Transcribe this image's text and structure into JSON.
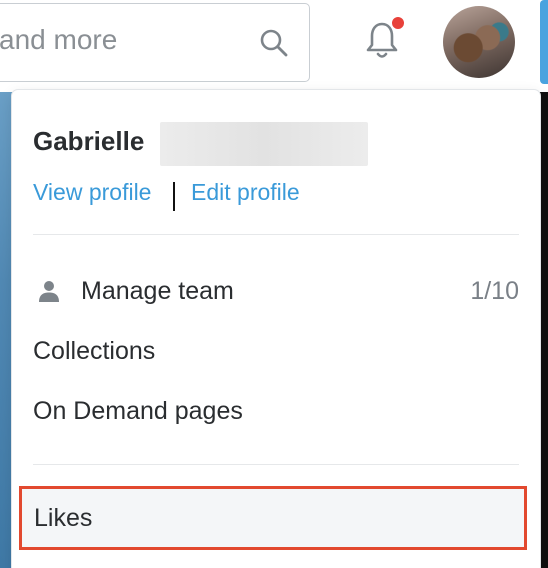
{
  "search": {
    "text": "and more",
    "icon": "search-icon"
  },
  "header": {
    "notifications_icon": "bell-icon",
    "notification_badge_color": "#e8413a",
    "avatar_alt": "user avatar"
  },
  "profile": {
    "name": "Gabrielle",
    "view_profile": "View profile",
    "edit_profile": "Edit profile"
  },
  "menu": {
    "manage_team": {
      "label": "Manage team",
      "count": "1/10",
      "icon": "person-icon"
    },
    "collections": "Collections",
    "on_demand": "On Demand pages",
    "likes": "Likes"
  },
  "colors": {
    "link": "#3a9ad9",
    "highlight_border": "#e2492f",
    "text": "#2a2d30",
    "muted": "#7a8087"
  }
}
